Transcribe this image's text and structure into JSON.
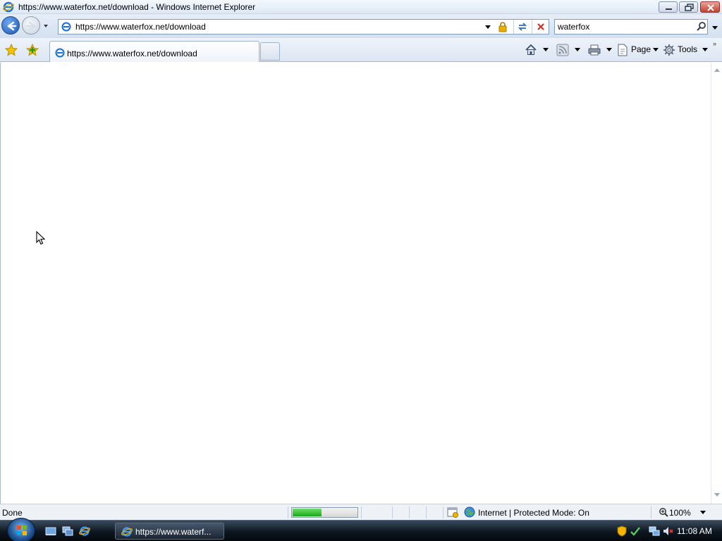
{
  "window": {
    "title": "https://www.waterfox.net/download - Windows Internet Explorer",
    "icon": "ie-icon"
  },
  "navigation": {
    "url": "https://www.waterfox.net/download",
    "search_query": "waterfox",
    "icons": [
      "back-icon",
      "forward-icon",
      "history-dropdown-icon",
      "page-icon",
      "address-dropdown-icon",
      "lock-icon",
      "refresh-icon",
      "stop-icon",
      "search-icon"
    ]
  },
  "tabs": [
    {
      "label": "https://www.waterfox.net/download",
      "active": true
    }
  ],
  "command_bar": {
    "page_label": "Page",
    "tools_label": "Tools",
    "icons": [
      "favorites-star-icon",
      "add-favorites-icon",
      "home-icon",
      "feeds-icon",
      "print-icon",
      "page-icon",
      "tools-gear-icon"
    ]
  },
  "status_bar": {
    "status_text": "Done",
    "progress": 0.45,
    "zone_text": "Internet | Protected Mode: On",
    "zoom": "100%"
  },
  "taskbar": {
    "task_label": "https://www.waterf...",
    "clock": "11:08 AM"
  },
  "colors": {
    "progress_fill": "#18a818",
    "close_button": "#c4412e",
    "taskbar_bg": "#0d1620"
  }
}
